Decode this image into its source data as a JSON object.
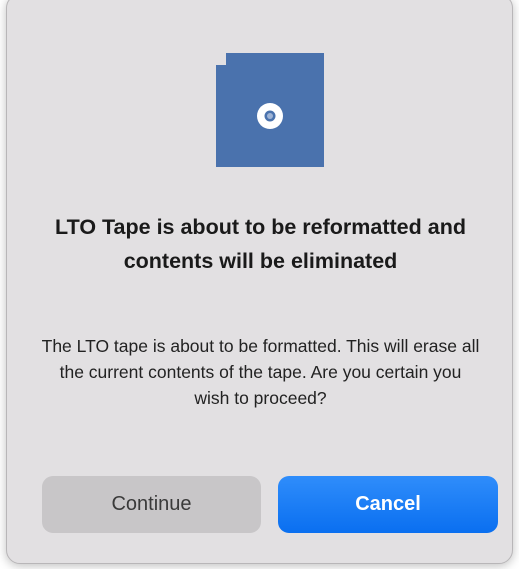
{
  "dialog": {
    "icon": "lto-tape-cartridge-icon",
    "title": "LTO Tape is about to be reformatted and contents will be eliminated",
    "message": "The LTO tape is about to be formatted. This will erase all the current contents of the tape.  Are you certain you wish to proceed?",
    "buttons": {
      "continue_label": "Continue",
      "cancel_label": "Cancel"
    }
  },
  "colors": {
    "dialog_background": "#e2e0e2",
    "icon_blue": "#4a72ad",
    "accent_blue": "#1479f5",
    "secondary_button": "#c8c6c8"
  }
}
